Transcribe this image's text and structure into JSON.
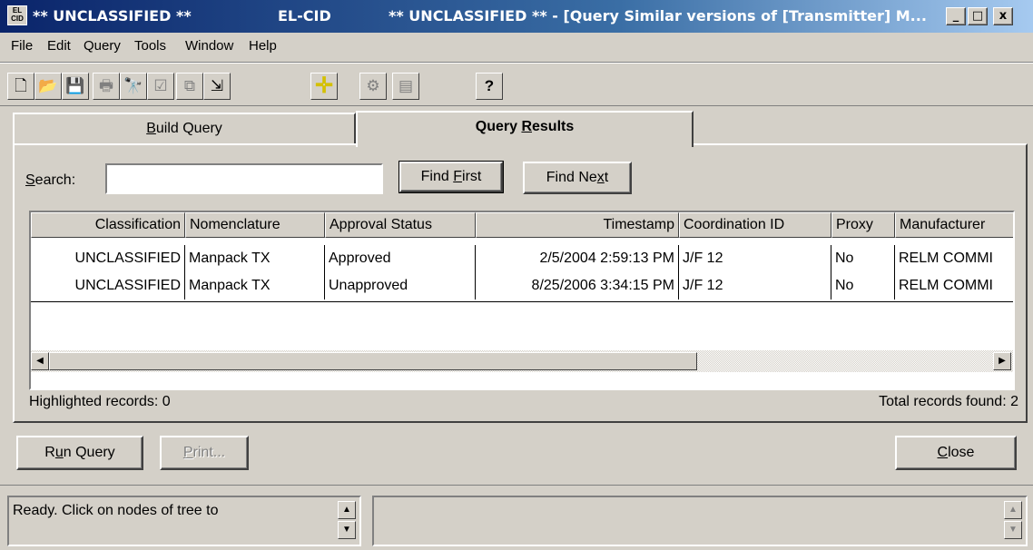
{
  "window": {
    "title_classification": "** UNCLASSIFIED **",
    "title_app": "EL-CID",
    "title_main": "** UNCLASSIFIED ** - [Query Similar versions of [Transmitter] M...",
    "app_icon_text": "ELCID",
    "minimize": "_",
    "maximize": "□",
    "close": "x"
  },
  "menu": [
    "File",
    "Edit",
    "Query",
    "Tools",
    "Window",
    "Help"
  ],
  "toolbar": [
    {
      "icon": "new-document-icon",
      "glyph": "🗋",
      "enabled": true
    },
    {
      "icon": "open-folder-icon",
      "glyph": "📂",
      "enabled": true
    },
    {
      "icon": "save-icon",
      "glyph": "💾",
      "enabled": false
    },
    {
      "icon": "print-icon",
      "glyph": "🖶",
      "enabled": false
    },
    {
      "icon": "binoculars-icon",
      "glyph": "🔭",
      "enabled": true
    },
    {
      "icon": "checklist-icon",
      "glyph": "☑",
      "enabled": false
    },
    {
      "icon": "copy-records-icon",
      "glyph": "⧉",
      "enabled": false
    },
    {
      "icon": "export-icon",
      "glyph": "⇲",
      "enabled": true
    },
    {
      "icon": "crosshair-icon",
      "glyph": "✛",
      "enabled": true
    },
    {
      "icon": "coordination-icon",
      "glyph": "⚙",
      "enabled": false
    },
    {
      "icon": "report-icon",
      "glyph": "▤",
      "enabled": false
    },
    {
      "icon": "help-icon",
      "glyph": "?",
      "enabled": true
    }
  ],
  "tabs": {
    "build_query": {
      "pre": "",
      "key": "B",
      "post": "uild Query"
    },
    "query_results": {
      "pre": "Query ",
      "key": "R",
      "post": "esults"
    }
  },
  "search": {
    "label_key": "S",
    "label_rest": "earch:",
    "value": "",
    "find_first": {
      "pre": "Find ",
      "key": "F",
      "post": "irst"
    },
    "find_next": {
      "pre": "Find Ne",
      "key": "x",
      "post": "t"
    }
  },
  "table": {
    "columns": [
      "Classification",
      "Nomenclature",
      "Approval Status",
      "Timestamp",
      "Coordination ID",
      "Proxy",
      "Manufacturer"
    ],
    "rows": [
      [
        "UNCLASSIFIED",
        "Manpack TX",
        "Approved",
        "2/5/2004 2:59:13 PM",
        "J/F 12",
        "No",
        "RELM COMMI"
      ],
      [
        "UNCLASSIFIED",
        "Manpack TX",
        "Unapproved",
        "8/25/2006 3:34:15 PM",
        "J/F 12",
        "No",
        "RELM COMMI"
      ]
    ]
  },
  "footer": {
    "highlighted": "Highlighted records: 0",
    "total": "Total records found: 2"
  },
  "buttons": {
    "run_query": {
      "pre": "R",
      "key": "u",
      "post": "n Query"
    },
    "print": {
      "pre": "",
      "key": "P",
      "post": "rint..."
    },
    "close": {
      "pre": "",
      "key": "C",
      "post": "lose"
    }
  },
  "status": {
    "message": "Ready.  Click on nodes of tree to"
  },
  "colors": {
    "titlebar_start": "#0a246a",
    "titlebar_end": "#a6caf0",
    "face": "#d4d0c8"
  }
}
